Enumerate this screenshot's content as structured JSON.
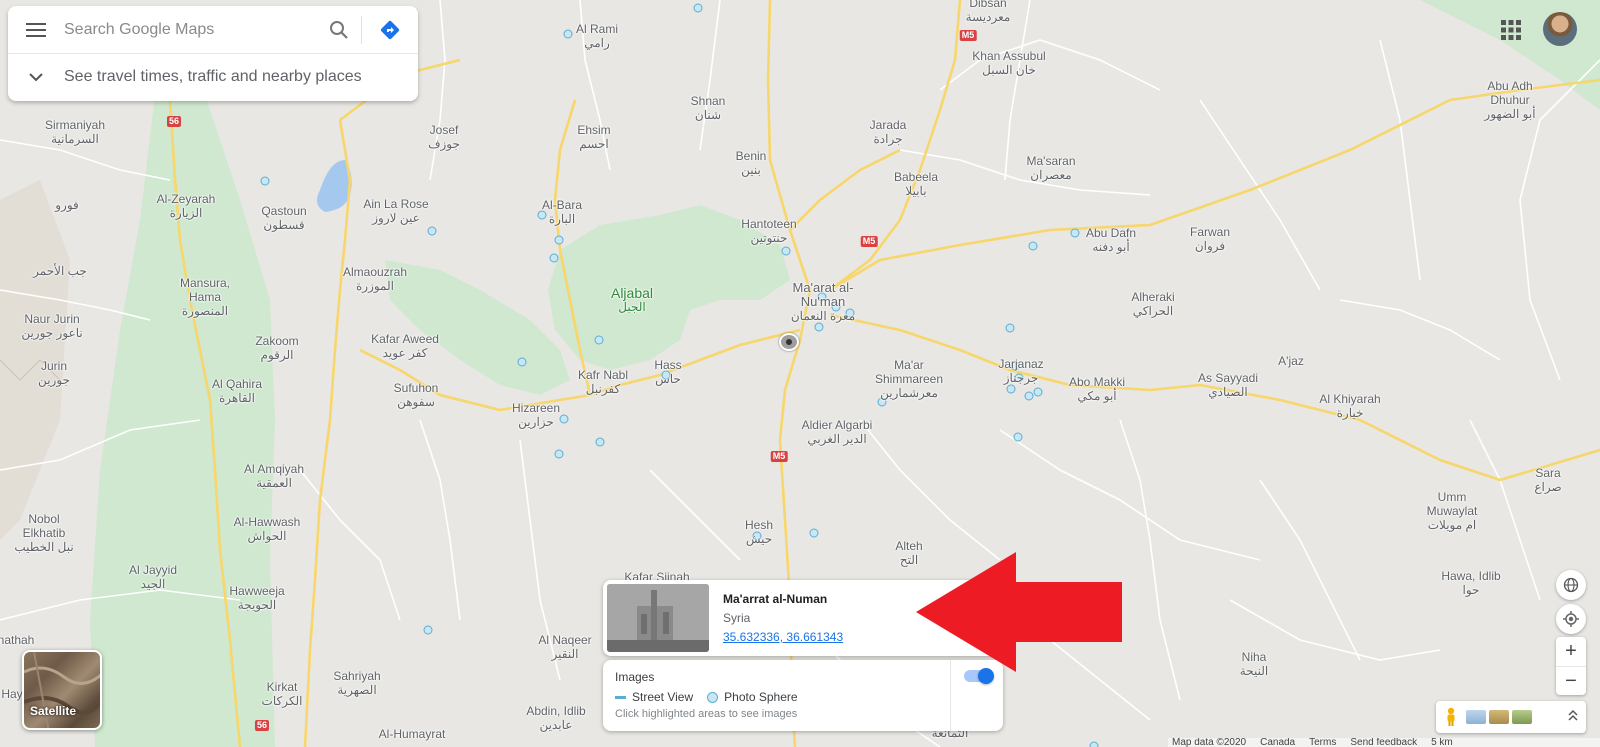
{
  "search": {
    "placeholder": "Search Google Maps",
    "travel_text": "See travel times, traffic and nearby places"
  },
  "satellite": {
    "label": "Satellite"
  },
  "place": {
    "name": "Ma'arrat al-Numan",
    "country": "Syria",
    "coordinates": "35.632336, 36.661343"
  },
  "images_panel": {
    "title": "Images",
    "street_view_label": "Street View",
    "photo_sphere_label": "Photo Sphere",
    "hint": "Click highlighted areas to see images",
    "toggle_on": true
  },
  "footer": {
    "map_data": "Map data ©2020",
    "region": "Canada",
    "terms": "Terms",
    "feedback": "Send feedback",
    "scale": "5 km"
  },
  "road_shields": [
    "M5",
    "M5",
    "M5",
    "56",
    "56"
  ],
  "places": [
    {
      "en": "Al Rami",
      "ar": "رامي"
    },
    {
      "en": "Dibsan",
      "ar": "معرديسة"
    },
    {
      "en": "Khan Assubul",
      "ar": "خان السبل"
    },
    {
      "en": "Abu Adh Dhuhur",
      "ar": "أبو الضهور"
    },
    {
      "en": "Sirmaniyah",
      "ar": "السرمانية"
    },
    {
      "en": "Josef",
      "ar": "جوزف"
    },
    {
      "en": "Shnan",
      "ar": "شنان"
    },
    {
      "en": "Ehsim",
      "ar": "احسم"
    },
    {
      "en": "Jarada",
      "ar": "جرادة"
    },
    {
      "en": "Benin",
      "ar": "بنين"
    },
    {
      "en": "Ma'saran",
      "ar": "معصران"
    },
    {
      "en": "Babeela",
      "ar": "بابيلا"
    },
    {
      "en": "Al-Zeyarah",
      "ar": "الزيارة"
    },
    {
      "en": "Qastoun",
      "ar": "قسطون"
    },
    {
      "en": "Ain La Rose",
      "ar": "عين لاروز"
    },
    {
      "en": "Al-Bara",
      "ar": "البارة"
    },
    {
      "en": "Hantoteen",
      "ar": "حنتوتين"
    },
    {
      "en": "Abu Dafn",
      "ar": "أبو دفنه"
    },
    {
      "en": "Farwan",
      "ar": "فروان"
    },
    {
      "en": "",
      "ar": "فورو"
    },
    {
      "en": "Mansura, Hama",
      "ar": "المنصورة"
    },
    {
      "en": "Almaouzrah",
      "ar": "الموزرة"
    },
    {
      "en": "Aljabal",
      "ar": "الجبل"
    },
    {
      "en": "Ma'arat al-Nu'man",
      "ar": "معرة النعمان"
    },
    {
      "en": "Alheraki",
      "ar": "الحراكي"
    },
    {
      "en": "",
      "ar": "جب الأحمر"
    },
    {
      "en": "Naur Jurin",
      "ar": "ناعور جورين"
    },
    {
      "en": "Zakoom",
      "ar": "الرقوم"
    },
    {
      "en": "Kafar Aweed",
      "ar": "كفر عويد"
    },
    {
      "en": "Kafr Nabl",
      "ar": "كفرنبل"
    },
    {
      "en": "Hass",
      "ar": "حاس"
    },
    {
      "en": "Ma'ar Shimmareen",
      "ar": "معرشمارين"
    },
    {
      "en": "Jarjanaz",
      "ar": "جرجناز"
    },
    {
      "en": "Abo Makki",
      "ar": "أبو مكي"
    },
    {
      "en": "As Sayyadi",
      "ar": "الصيادي"
    },
    {
      "en": "A'jaz",
      "ar": ""
    },
    {
      "en": "Jurin",
      "ar": "جورين"
    },
    {
      "en": "Al Qahira",
      "ar": "القاهرة"
    },
    {
      "en": "Sufuhon",
      "ar": "سفوهن"
    },
    {
      "en": "Hizareen",
      "ar": "حزارين"
    },
    {
      "en": "Aldier Algarbi",
      "ar": "الدير الغربي"
    },
    {
      "en": "Al Khiyarah",
      "ar": "خيارة"
    },
    {
      "en": "Al Amqiyah",
      "ar": "العمقية"
    },
    {
      "en": "Sara",
      "ar": "صراع"
    },
    {
      "en": "Al-Hawwash",
      "ar": "الحواش"
    },
    {
      "en": "Umm Muwaylat",
      "ar": "ام مويلات"
    },
    {
      "en": "Nobol Elkhatib",
      "ar": "نبل الخطيب"
    },
    {
      "en": "Hesh",
      "ar": "حيش"
    },
    {
      "en": "Alteh",
      "ar": "التح"
    },
    {
      "en": "Al Jayyid",
      "ar": "الجيد"
    },
    {
      "en": "Hawweeja",
      "ar": "الحويجة"
    },
    {
      "en": "Kafar Sijnah",
      "ar": ""
    },
    {
      "en": "Hawa, Idlib",
      "ar": "حوا"
    },
    {
      "en": "nathah",
      "ar": ""
    },
    {
      "en": "Al Naqeer",
      "ar": "النقير"
    },
    {
      "en": "Niha",
      "ar": "النيحة"
    },
    {
      "en": "Sahriyah",
      "ar": "الصهرية"
    },
    {
      "en": "Kirkat",
      "ar": "الكركات"
    },
    {
      "en": "Hay",
      "ar": ""
    },
    {
      "en": "Abdin, Idlib",
      "ar": "عابدين"
    },
    {
      "en": "Al-Humayrat",
      "ar": ""
    },
    {
      "en": "",
      "ar": "التمانعة"
    }
  ]
}
